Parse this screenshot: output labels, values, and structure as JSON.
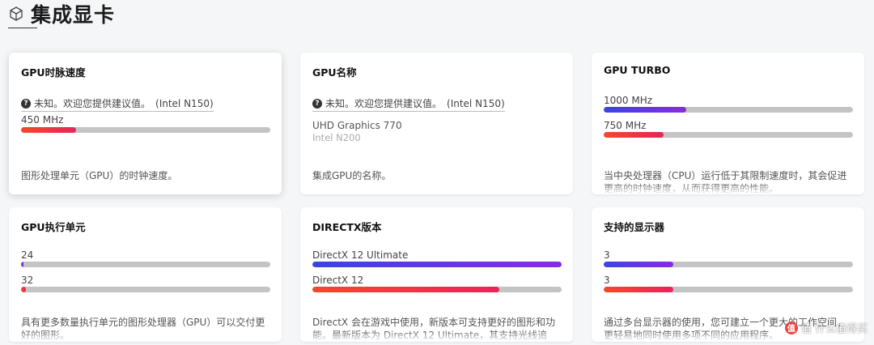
{
  "header": {
    "title": "集成显卡",
    "icon": "cube-icon"
  },
  "cards": {
    "clock": {
      "title": "GPU时脉速度",
      "unknown_text": "未知。欢迎您提供建议值。",
      "unknown_cpu": "(Intel N150)",
      "bar_label": "450 MHz",
      "bar_percent": 22,
      "description": "图形处理单元（GPU）的时钟速度。"
    },
    "name": {
      "title": "GPU名称",
      "unknown_text": "未知。欢迎您提供建议值。",
      "unknown_cpu": "(Intel N150)",
      "value": "UHD Graphics 770",
      "value_cpu": "Intel N200",
      "description": "集成GPU的名称。"
    },
    "turbo": {
      "title": "GPU TURBO",
      "bar1_label": "1000 MHz",
      "bar1_percent": 33,
      "bar2_label": "750 MHz",
      "bar2_percent": 24,
      "description": "当中央处理器（CPU）运行低于其限制速度时，其会促进更高的时钟速度，从而获得更高的性能。"
    },
    "eu": {
      "title": "GPU执行单元",
      "bar1_label": "24",
      "bar1_percent": 1,
      "bar2_label": "32",
      "bar2_percent": 2,
      "description": "具有更多数量执行单元的图形处理器（GPU）可以交付更好的图形。"
    },
    "directx": {
      "title": "DIRECTX版本",
      "bar1_label": "DirectX 12 Ultimate",
      "bar1_percent": 100,
      "bar2_label": "DirectX 12",
      "bar2_percent": 75,
      "description": "DirectX 会在游戏中使用，新版本可支持更好的图形和功能。最新版本为 DirectX 12 Ultimate，其支持光线追"
    },
    "displays": {
      "title": "支持的显示器",
      "bar1_label": "3",
      "bar1_percent": 28,
      "bar2_label": "3",
      "bar2_percent": 28,
      "description": "通过多台显示器的使用，您可建立一个更大的工作空间，更轻易地同时使用多项不同的应用程序。"
    }
  },
  "watermark": {
    "text": "值 什么值得买",
    "icon_letter": "值"
  },
  "colors": {
    "blue_start": "#3a45e0",
    "blue_end": "#8b2be0",
    "red_start": "#f14a2a",
    "red_end": "#e8255a",
    "track": "#c4c4c4"
  }
}
